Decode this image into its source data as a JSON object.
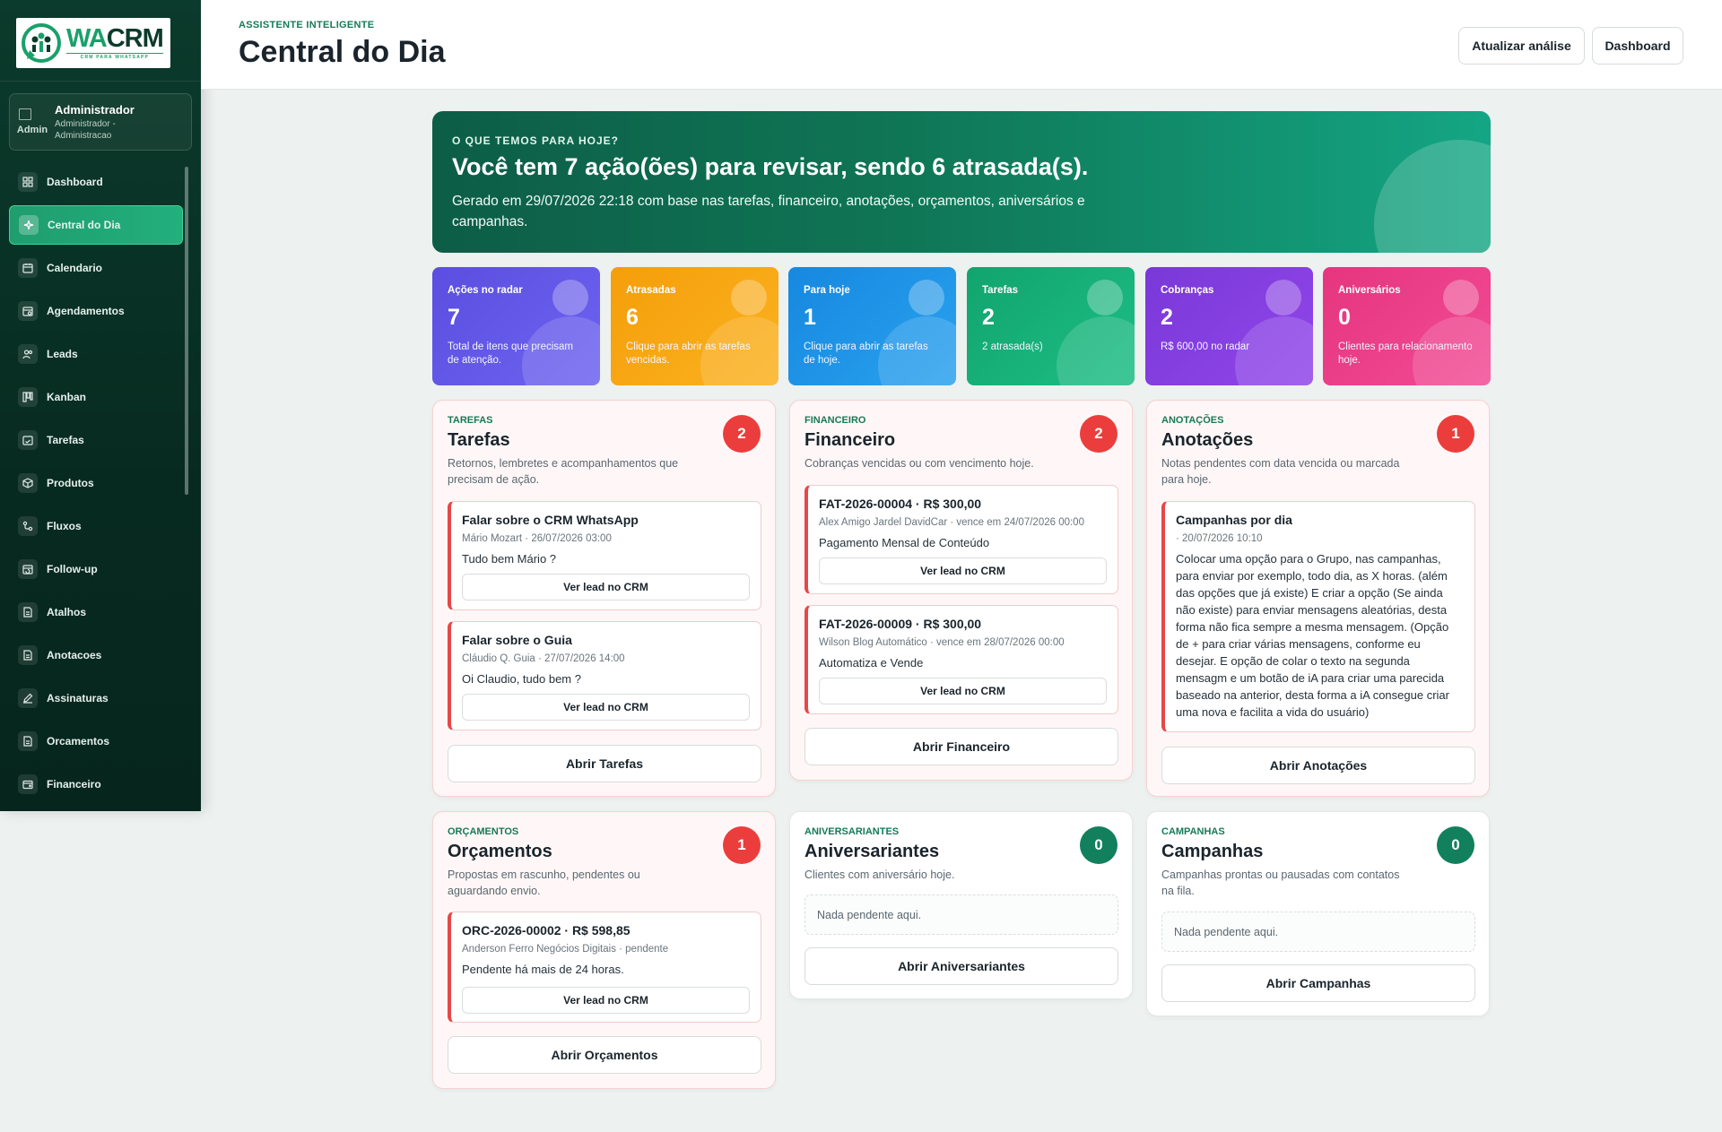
{
  "brand": {
    "wa": "WA",
    "crm": "CRM",
    "tagline": "CRM PARA WHATSAPP"
  },
  "user": {
    "avatar_alt": "Admin",
    "name": "Administrador",
    "role": "Administrador - Administracao"
  },
  "sidebar": {
    "items": [
      {
        "label": "Dashboard",
        "icon": "grid-icon"
      },
      {
        "label": "Central do Dia",
        "icon": "sparkle-icon",
        "active": true
      },
      {
        "label": "Calendario",
        "icon": "calendar-icon"
      },
      {
        "label": "Agendamentos",
        "icon": "calendar-clock-icon"
      },
      {
        "label": "Leads",
        "icon": "users-icon"
      },
      {
        "label": "Kanban",
        "icon": "kanban-icon"
      },
      {
        "label": "Tarefas",
        "icon": "calendar-check-icon"
      },
      {
        "label": "Produtos",
        "icon": "box-icon"
      },
      {
        "label": "Fluxos",
        "icon": "flow-icon"
      },
      {
        "label": "Follow-up",
        "icon": "calendar-repeat-icon"
      },
      {
        "label": "Atalhos",
        "icon": "document-icon"
      },
      {
        "label": "Anotacoes",
        "icon": "document-icon"
      },
      {
        "label": "Assinaturas",
        "icon": "pen-icon"
      },
      {
        "label": "Orcamentos",
        "icon": "document-icon"
      },
      {
        "label": "Financeiro",
        "icon": "wallet-icon"
      }
    ]
  },
  "header": {
    "kicker": "ASSISTENTE INTELIGENTE",
    "title": "Central do Dia",
    "update_button": "Atualizar análise",
    "dashboard_button": "Dashboard"
  },
  "hero": {
    "kicker": "O QUE TEMOS PARA HOJE?",
    "title": "Você tem 7 ação(ões) para revisar, sendo 6 atrasada(s).",
    "description": "Gerado em 29/07/2026 22:18 com base nas tarefas, financeiro, anotações, orçamentos, aniversários e campanhas."
  },
  "stats": [
    {
      "label": "Ações no radar",
      "value": "7",
      "desc": "Total de itens que precisam de atenção.",
      "color_from": "#5b4ee0",
      "color_to": "#6d63f0"
    },
    {
      "label": "Atrasadas",
      "value": "6",
      "desc": "Clique para abrir as tarefas vencidas.",
      "color_from": "#f59e0b",
      "color_to": "#fbb21f"
    },
    {
      "label": "Para hoje",
      "value": "1",
      "desc": "Clique para abrir as tarefas de hoje.",
      "color_from": "#1688e0",
      "color_to": "#2aa2ee"
    },
    {
      "label": "Tarefas",
      "value": "2",
      "desc": "2 atrasada(s)",
      "color_from": "#12a46e",
      "color_to": "#1cbe84"
    },
    {
      "label": "Cobranças",
      "value": "2",
      "desc": "R$ 600,00 no radar",
      "color_from": "#7a38d8",
      "color_to": "#9146ea"
    },
    {
      "label": "Aniversários",
      "value": "0",
      "desc": "Clientes para relacionamento hoje.",
      "color_from": "#e6357f",
      "color_to": "#f24b95"
    }
  ],
  "panels": {
    "tarefas": {
      "kicker": "TAREFAS",
      "title": "Tarefas",
      "count": "2",
      "desc": "Retornos, lembretes e acompanhamentos que precisam de ação.",
      "items": [
        {
          "title": "Falar sobre o CRM WhatsApp",
          "meta": "Mário Mozart · 26/07/2026 03:00",
          "text": "Tudo bem Mário ?",
          "button": "Ver lead no CRM"
        },
        {
          "title": "Falar sobre o Guia",
          "meta": "Cláudio Q. Guia · 27/07/2026 14:00",
          "text": "Oi Claudio, tudo bem ?",
          "button": "Ver lead no CRM"
        }
      ],
      "open_button": "Abrir Tarefas"
    },
    "financeiro": {
      "kicker": "FINANCEIRO",
      "title": "Financeiro",
      "count": "2",
      "desc": "Cobranças vencidas ou com vencimento hoje.",
      "items": [
        {
          "title": "FAT-2026-00004 · R$ 300,00",
          "meta": "Alex Amigo Jardel DavidCar · vence em 24/07/2026 00:00",
          "text": "Pagamento Mensal de Conteúdo",
          "button": "Ver lead no CRM"
        },
        {
          "title": "FAT-2026-00009 · R$ 300,00",
          "meta": "Wilson Blog Automático · vence em 28/07/2026 00:00",
          "text": "Automatiza e Vende",
          "button": "Ver lead no CRM"
        }
      ],
      "open_button": "Abrir Financeiro"
    },
    "anotacoes": {
      "kicker": "ANOTAÇÕES",
      "title": "Anotações",
      "count": "1",
      "desc": "Notas pendentes com data vencida ou marcada para hoje.",
      "items": [
        {
          "title": "Campanhas por dia",
          "meta": "· 20/07/2026 10:10",
          "text": "Colocar uma opção para o Grupo, nas campanhas, para enviar por exemplo, todo dia, as X horas. (além das opções que já existe) E criar a opção (Se ainda não existe) para enviar mensagens aleatórias, desta forma não fica sempre a mesma mensagem. (Opção de + para criar várias mensagens, conforme eu desejar. E opção de colar o texto na segunda mensagm e um botão de iA para criar uma parecida baseado na anterior, desta forma a iA consegue criar uma nova e facilita a vida do usuário)"
        }
      ],
      "open_button": "Abrir Anotações"
    },
    "orcamentos": {
      "kicker": "ORÇAMENTOS",
      "title": "Orçamentos",
      "count": "1",
      "desc": "Propostas em rascunho, pendentes ou aguardando envio.",
      "items": [
        {
          "title": "ORC-2026-00002 · R$ 598,85",
          "meta": "Anderson Ferro Negócios Digitais · pendente",
          "text": "Pendente há mais de 24 horas.",
          "button": "Ver lead no CRM"
        }
      ],
      "open_button": "Abrir Orçamentos"
    },
    "aniversariantes": {
      "kicker": "ANIVERSARIANTES",
      "title": "Aniversariantes",
      "count": "0",
      "desc": "Clientes com aniversário hoje.",
      "empty": "Nada pendente aqui.",
      "open_button": "Abrir Aniversariantes"
    },
    "campanhas": {
      "kicker": "CAMPANHAS",
      "title": "Campanhas",
      "count": "0",
      "desc": "Campanhas prontas ou pausadas com contatos na fila.",
      "empty": "Nada pendente aqui.",
      "open_button": "Abrir Campanhas"
    }
  }
}
